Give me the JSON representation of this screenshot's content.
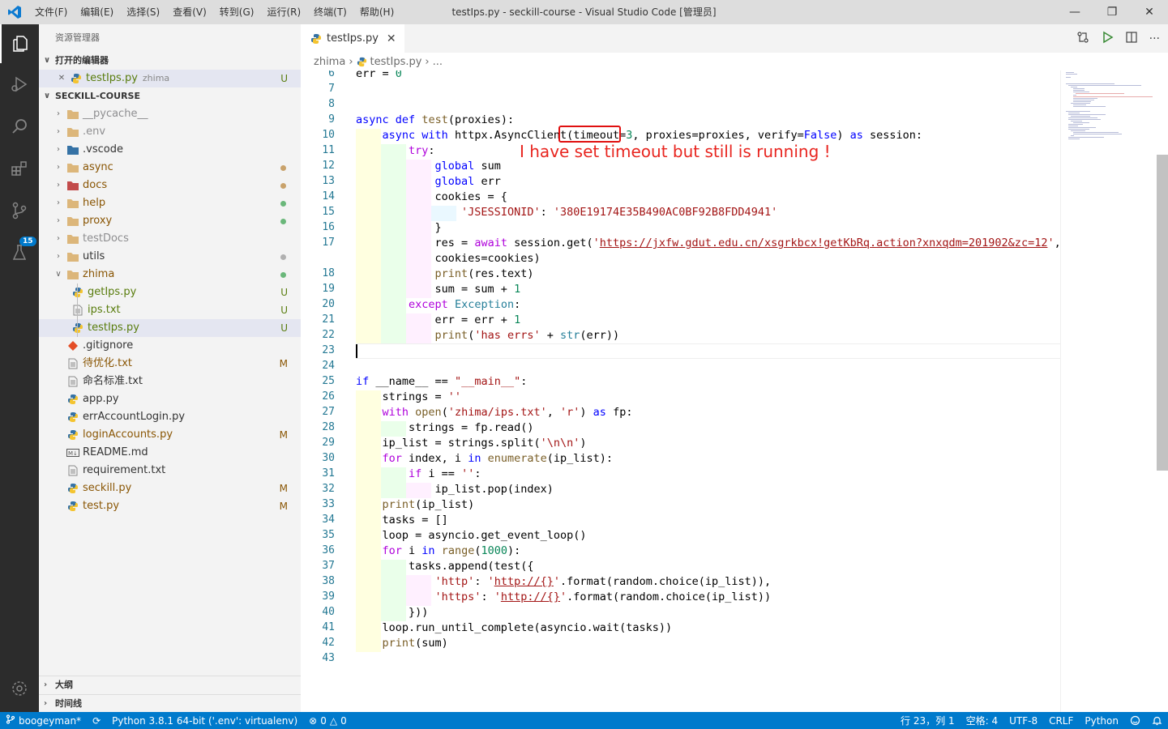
{
  "window": {
    "title": "testIps.py - seckill-course - Visual Studio Code [管理员]",
    "menu": [
      "文件(F)",
      "编辑(E)",
      "选择(S)",
      "查看(V)",
      "转到(G)",
      "运行(R)",
      "终端(T)",
      "帮助(H)"
    ]
  },
  "activity": {
    "scm_badge": "15"
  },
  "sidebar": {
    "title": "资源管理器",
    "open_editors_label": "打开的编辑器",
    "open_editor": {
      "name": "testIps.py",
      "folder": "zhima",
      "status": "U"
    },
    "workspace_label": "SECKILL-COURSE",
    "items": [
      {
        "name": "__pycache__",
        "status": ""
      },
      {
        "name": ".env",
        "status": ""
      },
      {
        "name": ".vscode",
        "status": ""
      },
      {
        "name": "async",
        "status": ""
      },
      {
        "name": "docs",
        "status": ""
      },
      {
        "name": "help",
        "status": ""
      },
      {
        "name": "proxy",
        "status": ""
      },
      {
        "name": "testDocs",
        "status": ""
      },
      {
        "name": "utils",
        "status": ""
      },
      {
        "name": "zhima",
        "status": ""
      },
      {
        "name": "getIps.py",
        "status": "U"
      },
      {
        "name": "ips.txt",
        "status": "U"
      },
      {
        "name": "testIps.py",
        "status": "U"
      },
      {
        "name": ".gitignore",
        "status": ""
      },
      {
        "name": "待优化.txt",
        "status": "M"
      },
      {
        "name": "命名标准.txt",
        "status": ""
      },
      {
        "name": "app.py",
        "status": ""
      },
      {
        "name": "errAccountLogin.py",
        "status": ""
      },
      {
        "name": "loginAccounts.py",
        "status": "M"
      },
      {
        "name": "README.md",
        "status": ""
      },
      {
        "name": "requirement.txt",
        "status": ""
      },
      {
        "name": "seckill.py",
        "status": "M"
      },
      {
        "name": "test.py",
        "status": "M"
      }
    ],
    "outline_label": "大纲",
    "timeline_label": "时间线"
  },
  "editor": {
    "tab": "testIps.py",
    "breadcrumb": [
      "zhima",
      "testIps.py",
      "..."
    ],
    "annotation": "I have set timeout but still is running !",
    "line_numbers": [
      "6",
      "7",
      "8",
      "9",
      "10",
      "11",
      "12",
      "13",
      "14",
      "15",
      "16",
      "17",
      "",
      "18",
      "19",
      "20",
      "21",
      "22",
      "23",
      "24",
      "25",
      "26",
      "27",
      "28",
      "29",
      "30",
      "31",
      "32",
      "33",
      "34",
      "35",
      "36",
      "37",
      "38",
      "39",
      "40",
      "41",
      "42",
      "43"
    ]
  },
  "statusbar": {
    "branch": "boogeyman*",
    "python": "Python 3.8.1 64-bit ('.env': virtualenv)",
    "errors": "0",
    "warnings": "0",
    "position": "行 23，列 1",
    "spaces": "空格: 4",
    "encoding": "UTF-8",
    "eol": "CRLF",
    "language": "Python"
  }
}
